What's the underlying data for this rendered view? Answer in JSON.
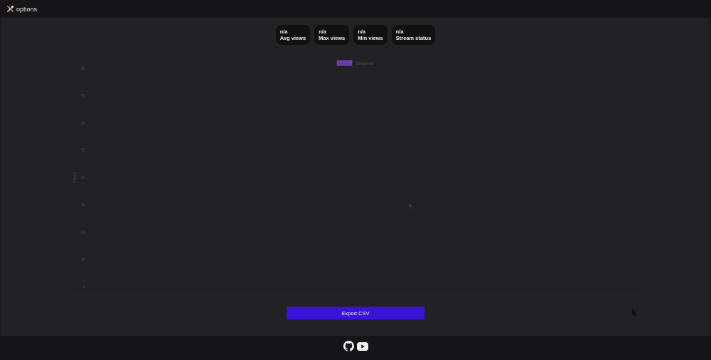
{
  "header": {
    "options_label": "options",
    "options_icon": "tools-icon"
  },
  "stats": [
    {
      "value": "n/a",
      "label": "Avg views"
    },
    {
      "value": "n/a",
      "label": "Max views"
    },
    {
      "value": "n/a",
      "label": "Min views"
    },
    {
      "value": "n/a",
      "label": "Stream status"
    }
  ],
  "chart_data": {
    "type": "line",
    "title": "",
    "xlabel": "",
    "ylabel": "Views",
    "ylim": [
      0,
      80
    ],
    "yticks": [
      0,
      10,
      20,
      30,
      40,
      50,
      60,
      70,
      80
    ],
    "legend_position": "top-center",
    "grid": false,
    "series": [
      {
        "name": "Streamer",
        "color": "#6a3aa8",
        "x": [],
        "y": []
      }
    ]
  },
  "export": {
    "label": "Export CSV",
    "color": "#3b12d9"
  },
  "footer": {
    "links": [
      {
        "icon": "github-icon"
      },
      {
        "icon": "youtube-icon"
      }
    ]
  }
}
